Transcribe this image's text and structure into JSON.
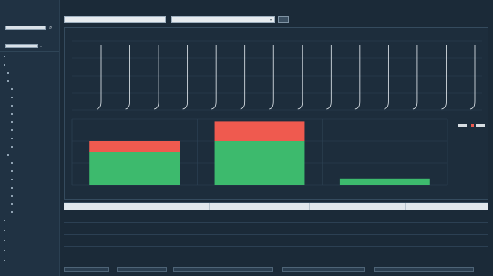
{
  "sidebar": {
    "logo_title": "",
    "logo_sub": "",
    "search_placeholder": "",
    "select_value": "",
    "items": [
      {
        "label": "",
        "level": 0
      },
      {
        "label": "",
        "level": 0
      },
      {
        "label": "",
        "level": 1
      },
      {
        "label": "",
        "level": 1
      },
      {
        "label": "",
        "level": 2
      },
      {
        "label": "",
        "level": 2
      },
      {
        "label": "",
        "level": 2
      },
      {
        "label": "",
        "level": 2
      },
      {
        "label": "",
        "level": 2
      },
      {
        "label": "",
        "level": 2
      },
      {
        "label": "",
        "level": 2
      },
      {
        "label": "",
        "level": 2
      },
      {
        "label": "",
        "level": 1
      },
      {
        "label": "",
        "level": 2
      },
      {
        "label": "",
        "level": 2
      },
      {
        "label": "",
        "level": 2
      },
      {
        "label": "",
        "level": 2
      },
      {
        "label": "",
        "level": 2
      },
      {
        "label": "",
        "level": 2
      },
      {
        "label": "",
        "level": 2
      },
      {
        "label": "",
        "level": 0
      },
      {
        "label": "",
        "level": 0
      },
      {
        "label": "",
        "level": 0
      },
      {
        "label": "",
        "level": 0
      },
      {
        "label": "",
        "level": 0
      }
    ]
  },
  "toolbar": {
    "filter1": "",
    "filter2": "",
    "apply_label": ""
  },
  "chart_top": {
    "title": "",
    "spike_count": 14
  },
  "chart_data": {
    "type": "bar",
    "title": "",
    "categories": [
      "",
      "",
      ""
    ],
    "series": [
      {
        "values": [
          3,
          4,
          0.6
        ],
        "color": "#3dba6d"
      },
      {
        "values": [
          1.0,
          1.8,
          0
        ],
        "color": "#ef5a4f"
      }
    ],
    "data_labels": [
      "",
      "",
      ""
    ],
    "ylim": [
      0,
      6
    ],
    "grid": true
  },
  "colors": {
    "green": "#3dba6d",
    "red": "#ef5a4f",
    "spike": "#e8eef3"
  },
  "table": {
    "columns": [
      "",
      "",
      "",
      ""
    ],
    "rows": [
      [
        "",
        "",
        "",
        ""
      ],
      [
        "",
        "",
        "",
        ""
      ],
      [
        "",
        "",
        "",
        ""
      ]
    ]
  },
  "footer": {
    "left_label": "",
    "right_label": "",
    "selects": [
      "",
      "",
      "",
      "",
      ""
    ]
  }
}
